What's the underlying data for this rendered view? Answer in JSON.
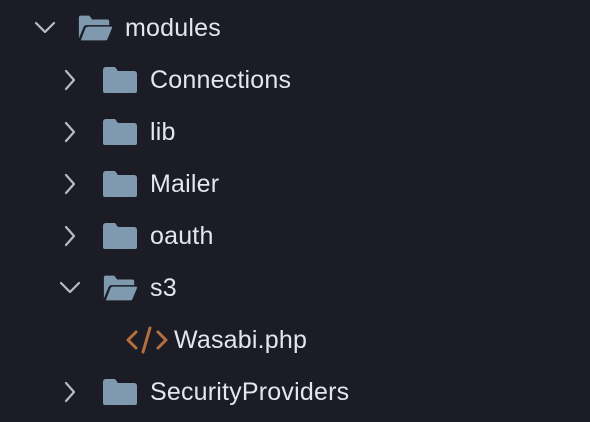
{
  "explorer": {
    "root": {
      "label": "modules",
      "expanded": true,
      "icon": "folder-open-icon"
    },
    "items": [
      {
        "label": "Connections",
        "type": "folder",
        "expanded": false,
        "icon": "folder-icon"
      },
      {
        "label": "lib",
        "type": "folder",
        "expanded": false,
        "icon": "folder-icon"
      },
      {
        "label": "Mailer",
        "type": "folder",
        "expanded": false,
        "icon": "folder-icon"
      },
      {
        "label": "oauth",
        "type": "folder",
        "expanded": false,
        "icon": "folder-icon"
      },
      {
        "label": "s3",
        "type": "folder",
        "expanded": true,
        "icon": "folder-open-icon",
        "children": [
          {
            "label": "Wasabi.php",
            "type": "file",
            "icon": "code-file-icon"
          }
        ]
      },
      {
        "label": "SecurityProviders",
        "type": "folder",
        "expanded": false,
        "icon": "folder-icon"
      }
    ]
  },
  "colors": {
    "background": "#1b1c26",
    "text": "#e3e6ec",
    "chevron": "#b7bcc6",
    "folder": "#7f9aae",
    "php_icon": "#b5703f"
  }
}
